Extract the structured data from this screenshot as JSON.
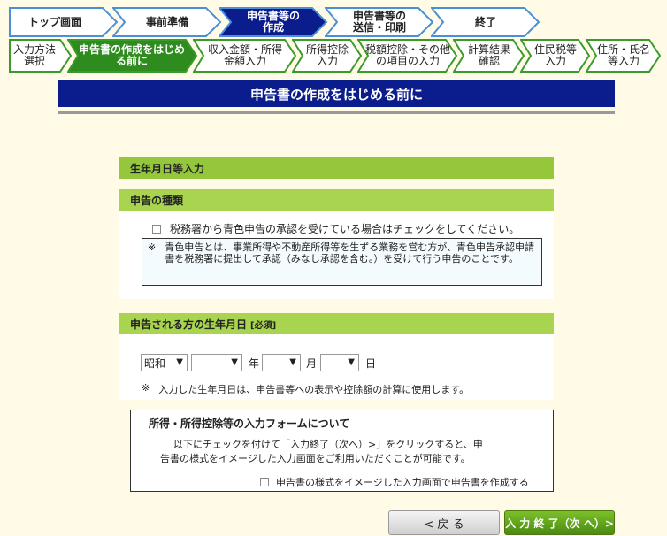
{
  "steps_main": [
    {
      "label": "トップ画面"
    },
    {
      "label": "事前準備"
    },
    {
      "label": "申告書等の\n作成"
    },
    {
      "label": "申告書等の\n送信・印刷"
    },
    {
      "label": "終了"
    }
  ],
  "steps_sub": [
    {
      "label": "入力方法\n選択"
    },
    {
      "label": "申告書の作成をはじめ\nる前に"
    },
    {
      "label": "収入金額・所得\n金額入力"
    },
    {
      "label": "所得控除\n入力"
    },
    {
      "label": "税額控除・その他\nの項目の入力"
    },
    {
      "label": "計算結果\n確認"
    },
    {
      "label": "住民税等\n入力"
    },
    {
      "label": "住所・氏名\n等入力"
    }
  ],
  "page_title": "申告書の作成をはじめる前に",
  "section_main": "生年月日等入力",
  "shinkoku": {
    "heading": "申告の種類",
    "checkbox_label": "税務署から青色申告の承認を受けている場合はチェックをしてください。",
    "note_mark": "※",
    "note": "青色申告とは、事業所得や不動産所得等を生ずる業務を営む方が、青色申告承認申請書を税務署に提出して承認（みなし承認を含む。）を受けて行う申告のことです。"
  },
  "birth": {
    "heading": "申告される方の生年月日",
    "required": "[必須]",
    "era_value": "昭和",
    "year_value": "",
    "month_value": "",
    "day_value": "",
    "year_unit": "年",
    "month_unit": "月",
    "day_unit": "日",
    "note_mark": "※",
    "note": "入力した生年月日は、申告書等への表示や控除額の計算に使用します。"
  },
  "form_info": {
    "heading": "所得・所得控除等の入力フォームについて",
    "text1": "以下にチェックを付けて「入力終了（次へ）>」をクリックすると、申",
    "text2": "告書の様式をイメージした入力画面をご利用いただくことが可能です。",
    "checkbox_label": "申告書の様式をイメージした入力画面で申告書を作成する"
  },
  "buttons": {
    "back": "<  戻 る",
    "next": "入 力 終 了（次 へ）>"
  },
  "colors": {
    "title_bg": "#0b1c8c",
    "section_green": "#a8d44f",
    "active_step": "#0b1c8c",
    "active_sub": "#2e8b1e"
  }
}
